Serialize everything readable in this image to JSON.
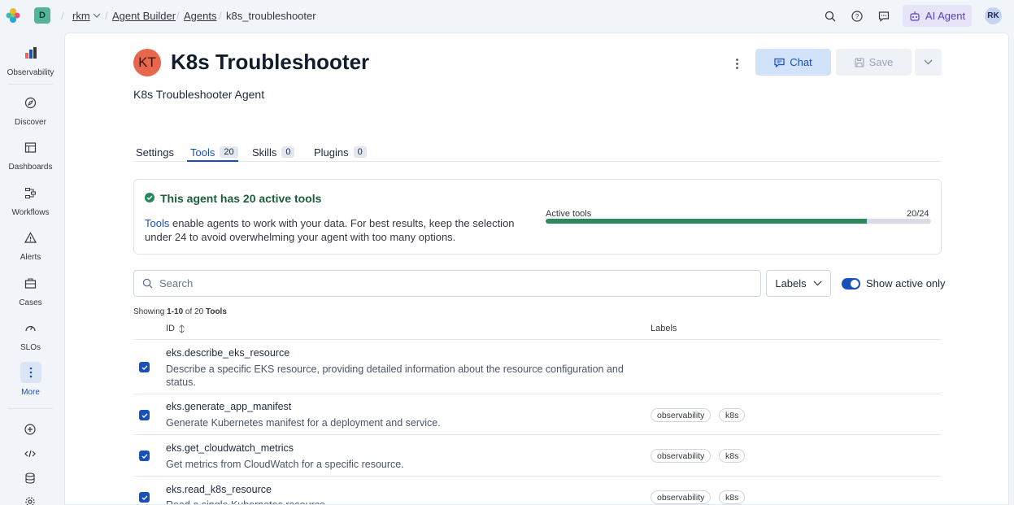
{
  "topbar": {
    "space_initial": "D",
    "breadcrumbs": [
      "rkm",
      "Agent Builder",
      "Agents",
      "k8s_troubleshooter"
    ],
    "ai_agent_label": "AI Agent",
    "user_initials": "RK"
  },
  "sidebar": {
    "items": [
      {
        "label": "Observability",
        "icon": "observability-icon"
      },
      {
        "label": "Discover",
        "icon": "discover-icon"
      },
      {
        "label": "Dashboards",
        "icon": "dashboards-icon"
      },
      {
        "label": "Workflows",
        "icon": "workflows-icon"
      },
      {
        "label": "Alerts",
        "icon": "alerts-icon"
      },
      {
        "label": "Cases",
        "icon": "cases-icon"
      },
      {
        "label": "SLOs",
        "icon": "slos-icon"
      },
      {
        "label": "More",
        "icon": "more-icon"
      }
    ]
  },
  "agent": {
    "initials": "KT",
    "title": "K8s Troubleshooter",
    "subtitle": "K8s Troubleshooter Agent"
  },
  "actions": {
    "chat_label": "Chat",
    "save_label": "Save"
  },
  "tabs": [
    {
      "label": "Settings",
      "count": ""
    },
    {
      "label": "Tools",
      "count": "20"
    },
    {
      "label": "Skills",
      "count": "0"
    },
    {
      "label": "Plugins",
      "count": "0"
    }
  ],
  "info": {
    "title": "This agent has 20 active tools",
    "link": "Tools",
    "text": " enable agents to work with your data. For best results, keep the selection under 24 to avoid overwhelming your agent with too many options.",
    "progress_label": "Active tools",
    "progress_count": "20/24",
    "progress_fraction": 0.8333,
    "accent": "#2a8a5a"
  },
  "filters": {
    "search_placeholder": "Search",
    "labels_button": "Labels",
    "toggle_label": "Show active only",
    "toggle_on": true
  },
  "table": {
    "showing_prefix": "Showing ",
    "showing_range": "1-10",
    "showing_of": " of 20 ",
    "showing_unit": "Tools",
    "col_id": "ID",
    "col_labels": "Labels",
    "rows": [
      {
        "id": "eks.describe_eks_resource",
        "desc": "Describe a specific EKS resource, providing detailed information about the resource configuration and status.",
        "labels": []
      },
      {
        "id": "eks.generate_app_manifest",
        "desc": "Generate Kubernetes manifest for a deployment and service.",
        "labels": [
          "observability",
          "k8s"
        ]
      },
      {
        "id": "eks.get_cloudwatch_metrics",
        "desc": "Get metrics from CloudWatch for a specific resource.",
        "labels": [
          "observability",
          "k8s"
        ]
      },
      {
        "id": "eks.read_k8s_resource",
        "desc": "Read a single Kubernetes resource.",
        "labels": [
          "observability",
          "k8s"
        ]
      }
    ]
  }
}
